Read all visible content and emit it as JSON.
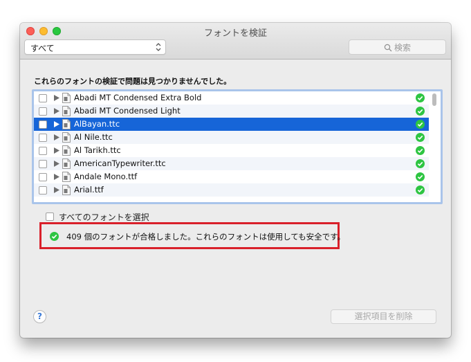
{
  "window": {
    "title": "フォントを検証"
  },
  "toolbar": {
    "filter_selected": "すべて",
    "search_placeholder": "検索"
  },
  "heading": "これらのフォントの検証で問題は見つかりませんでした。",
  "font_list": {
    "rows": [
      {
        "name": "Abadi MT Condensed Extra Bold",
        "checked": false,
        "selected": false,
        "status": "ok"
      },
      {
        "name": "Abadi MT Condensed Light",
        "checked": false,
        "selected": false,
        "status": "ok"
      },
      {
        "name": "AlBayan.ttc",
        "checked": false,
        "selected": true,
        "status": "ok"
      },
      {
        "name": "Al Nile.ttc",
        "checked": false,
        "selected": false,
        "status": "ok"
      },
      {
        "name": "Al Tarikh.ttc",
        "checked": false,
        "selected": false,
        "status": "ok"
      },
      {
        "name": "AmericanTypewriter.ttc",
        "checked": false,
        "selected": false,
        "status": "ok"
      },
      {
        "name": "Andale Mono.ttf",
        "checked": false,
        "selected": false,
        "status": "ok"
      },
      {
        "name": "Arial.ttf",
        "checked": false,
        "selected": false,
        "status": "ok"
      }
    ]
  },
  "select_all_label": "すべてのフォントを選択",
  "result_message": "409 個のフォントが合格しました。これらのフォントは使用しても安全です。",
  "help_label": "?",
  "delete_button_label": "選択項目を削除",
  "colors": {
    "selection": "#1665d8",
    "ok_green": "#2ec542",
    "highlight_border": "#d9202a"
  }
}
